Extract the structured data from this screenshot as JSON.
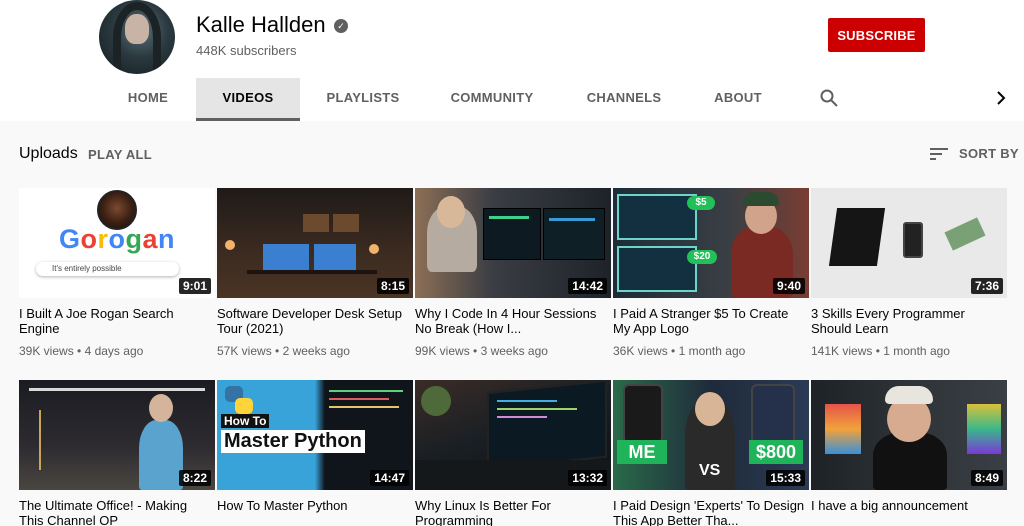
{
  "channel": {
    "name": "Kalle Hallden",
    "subscribers": "448K subscribers",
    "subscribe_label": "SUBSCRIBE"
  },
  "tabs": [
    "HOME",
    "VIDEOS",
    "PLAYLISTS",
    "COMMUNITY",
    "CHANNELS",
    "ABOUT"
  ],
  "active_tab": "VIDEOS",
  "section": {
    "title": "Uploads",
    "play_all": "PLAY ALL",
    "sort_by": "SORT BY"
  },
  "videos": [
    {
      "title": "I Built A Joe Rogan Search Engine",
      "duration": "9:01",
      "views": "39K views",
      "age": "4 days ago",
      "thumb_text": "Gorogan",
      "thumb_search": "It's entirely possible"
    },
    {
      "title": "Software Developer Desk Setup Tour (2021)",
      "duration": "8:15",
      "views": "57K views",
      "age": "2 weeks ago"
    },
    {
      "title": "Why I Code In 4 Hour Sessions No Break (How I...",
      "duration": "14:42",
      "views": "99K views",
      "age": "3 weeks ago"
    },
    {
      "title": "I Paid A Stranger $5 To Create My App Logo",
      "duration": "9:40",
      "views": "36K views",
      "age": "1 month ago",
      "price_a": "$5",
      "price_b": "$20"
    },
    {
      "title": "3 Skills Every Programmer Should Learn",
      "duration": "7:36",
      "views": "141K views",
      "age": "1 month ago"
    },
    {
      "title": "The Ultimate Office! - Making This Channel OP",
      "duration": "8:22",
      "views": "",
      "age": ""
    },
    {
      "title": "How To Master Python",
      "duration": "14:47",
      "views": "",
      "age": "",
      "thumb_small": "How To",
      "thumb_big": "Master Python"
    },
    {
      "title": "Why Linux Is Better For Programming",
      "duration": "13:32",
      "views": "",
      "age": ""
    },
    {
      "title": "I Paid Design 'Experts' To Design This App Better Tha...",
      "duration": "15:33",
      "views": "",
      "age": "",
      "label_me": "ME",
      "label_vs": "VS",
      "label_price": "$800"
    },
    {
      "title": "I have a big announcement",
      "duration": "8:49",
      "views": "",
      "age": ""
    }
  ],
  "colors": {
    "subscribe": "#cc0000",
    "background": "#f9f9f9",
    "header": "#ffffff",
    "secondary_text": "#606060"
  },
  "icons": [
    "verified-icon",
    "search-icon",
    "chevron-right-icon",
    "sort-icon"
  ]
}
